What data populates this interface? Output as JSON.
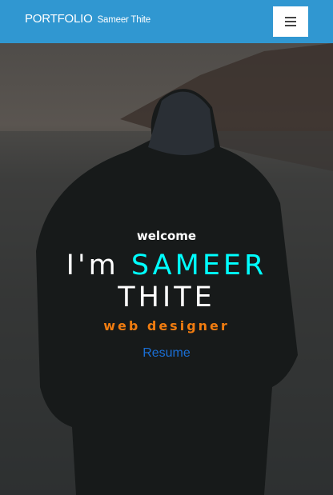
{
  "navbar": {
    "brand": "PORTFOLIO",
    "brand_sub": "Sameer Thite",
    "menu_icon": "hamburger-icon",
    "background": "#3097d1"
  },
  "hero": {
    "welcome": "welcome",
    "intro": "I'm",
    "first_name": "SAMEER",
    "last_name": "THITE",
    "role": "web designer",
    "resume_link": "Resume",
    "colors": {
      "highlight": "#00ffff",
      "role": "#f07c10",
      "link": "#1a6fd6"
    }
  }
}
